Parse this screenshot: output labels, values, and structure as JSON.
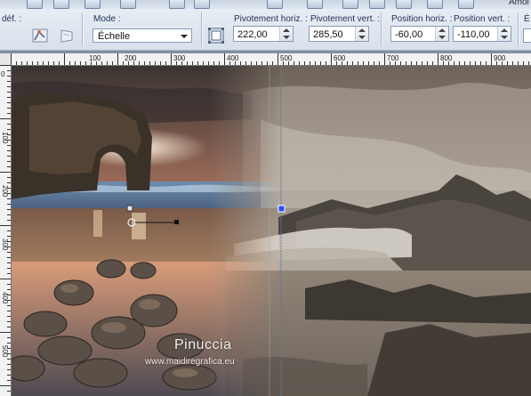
{
  "toolbar": {
    "top_right_text": "Amoi",
    "def_label": "déf. :",
    "mode_label": "Mode :",
    "mode_value": "Échelle",
    "rot_h_label": "Pivotement horiz. :",
    "rot_h_value": "222,00",
    "rot_v_label": "Pivotement vert. :",
    "rot_v_value": "285,50",
    "pos_h_label": "Position horiz. :",
    "pos_h_value": "-60,00",
    "pos_v_label": "Position vert. :",
    "pos_v_value": "-110,00",
    "edge_label": "É"
  },
  "ruler": {
    "top_marks": [
      "100",
      "200",
      "300",
      "400",
      "500",
      "600",
      "700",
      "800",
      "900"
    ],
    "left_marks": [
      "0",
      "100",
      "200",
      "300",
      "400",
      "500"
    ]
  },
  "canvas": {
    "watermark_name": "Pinuccia",
    "watermark_url": "www.maidiregrafica.eu"
  },
  "colors": {
    "guide_line": "#5a7a9a",
    "handle_fill": "#2a4cff"
  }
}
